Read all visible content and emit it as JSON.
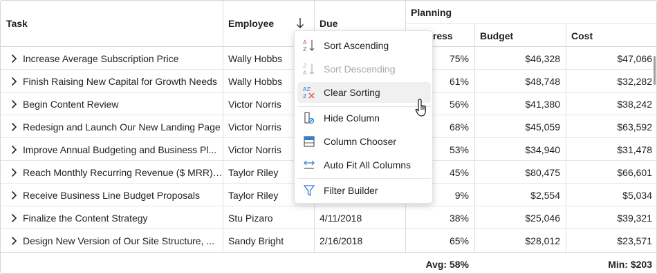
{
  "columns": {
    "task": "Task",
    "employee": "Employee",
    "due": "Due",
    "planning": "Planning",
    "progress": "Progress",
    "budget": "Budget",
    "cost": "Cost"
  },
  "sort_icon": "sort-descending-arrow-icon",
  "rows": [
    {
      "task": "Increase Average Subscription Price",
      "employee": "Wally Hobbs",
      "due": "",
      "progress": "75%",
      "budget": "$46,328",
      "cost": "$47,066"
    },
    {
      "task": "Finish Raising New Capital for Growth Needs",
      "employee": "Wally Hobbs",
      "due": "",
      "progress": "61%",
      "budget": "$48,748",
      "cost": "$32,282"
    },
    {
      "task": "Begin Content Review",
      "employee": "Victor Norris",
      "due": "",
      "progress": "56%",
      "budget": "$41,380",
      "cost": "$38,242"
    },
    {
      "task": "Redesign and Launch Our New Landing Page",
      "employee": "Victor Norris",
      "due": "",
      "progress": "68%",
      "budget": "$45,059",
      "cost": "$63,592"
    },
    {
      "task": "Improve Annual Budgeting and Business Pl...",
      "employee": "Victor Norris",
      "due": "",
      "progress": "53%",
      "budget": "$34,940",
      "cost": "$31,478"
    },
    {
      "task": "Reach Monthly Recurring Revenue ($ MRR) ...",
      "employee": "Taylor Riley",
      "due": "",
      "progress": "45%",
      "budget": "$80,475",
      "cost": "$66,601"
    },
    {
      "task": "Receive Business Line Budget Proposals",
      "employee": "Taylor Riley",
      "due": "",
      "progress": "9%",
      "budget": "$2,554",
      "cost": "$5,034"
    },
    {
      "task": "Finalize the Content Strategy",
      "employee": "Stu Pizaro",
      "due": "4/11/2018",
      "progress": "38%",
      "budget": "$25,046",
      "cost": "$39,321"
    },
    {
      "task": "Design New Version of Our Site Structure, ...",
      "employee": "Sandy Bright",
      "due": "2/16/2018",
      "progress": "65%",
      "budget": "$28,012",
      "cost": "$23,571"
    }
  ],
  "footer": {
    "progress_summary": "Avg: 58%",
    "cost_summary": "Min: $203"
  },
  "context_menu": {
    "items": [
      {
        "label": "Sort Ascending",
        "icon": "sort-ascending-icon",
        "disabled": false
      },
      {
        "label": "Sort Descending",
        "icon": "sort-descending-icon",
        "disabled": true
      },
      {
        "label": "Clear Sorting",
        "icon": "clear-sorting-icon",
        "disabled": false,
        "hovered": true
      },
      {
        "label": "Hide Column",
        "icon": "hide-column-icon",
        "disabled": false
      },
      {
        "label": "Column Chooser",
        "icon": "column-chooser-icon",
        "disabled": false
      },
      {
        "label": "Auto Fit All Columns",
        "icon": "auto-fit-columns-icon",
        "disabled": false
      },
      {
        "label": "Filter Builder",
        "icon": "filter-builder-icon",
        "disabled": false
      }
    ]
  },
  "colors": {
    "accent_blue": "#2f7ed8",
    "accent_red": "#e04a3f",
    "disabled_text": "#a9a9a9",
    "hover_bg": "#f0f0f0",
    "border": "#d6d6d6"
  }
}
